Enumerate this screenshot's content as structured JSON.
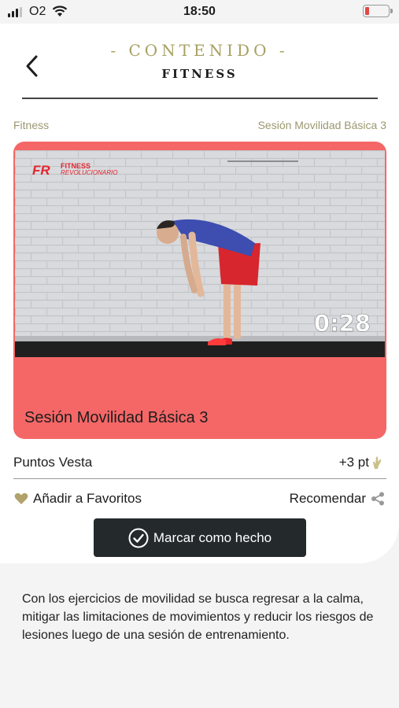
{
  "status_bar": {
    "carrier": "O2",
    "time": "18:50",
    "battery_level": 0.15,
    "battery_color": "#e24848"
  },
  "header": {
    "back_icon": "chevron-left-icon",
    "title": "- CONTENIDO -",
    "subtitle": "FITNESS"
  },
  "breadcrumb": {
    "category": "Fitness",
    "item": "Sesión Movilidad Básica 3"
  },
  "media": {
    "logo_text_main": "FITNESS",
    "logo_text_sub": "REVOLUCIONARIO",
    "logo_mark": "FR",
    "duration": "0:28",
    "title": "Sesión Movilidad Básica 3",
    "accent_color": "#f56767"
  },
  "points": {
    "label": "Puntos Vesta",
    "value": "+3 pt",
    "icon": "hand-icon"
  },
  "actions": {
    "favorites_label": "Añadir a Favoritos",
    "favorites_icon": "heart-icon",
    "recommend_label": "Recomendar",
    "recommend_icon": "share-icon",
    "done_label": "Marcar como hecho",
    "done_icon": "check-circle-icon"
  },
  "description": "Con los ejercicios de movilidad se busca regresar a la calma, mitigar las limitaciones de movimientos y reducir los riesgos de lesiones luego de una sesión de entrenamiento.",
  "colors": {
    "gold": "#a8a062",
    "dark_button": "#24292c"
  }
}
